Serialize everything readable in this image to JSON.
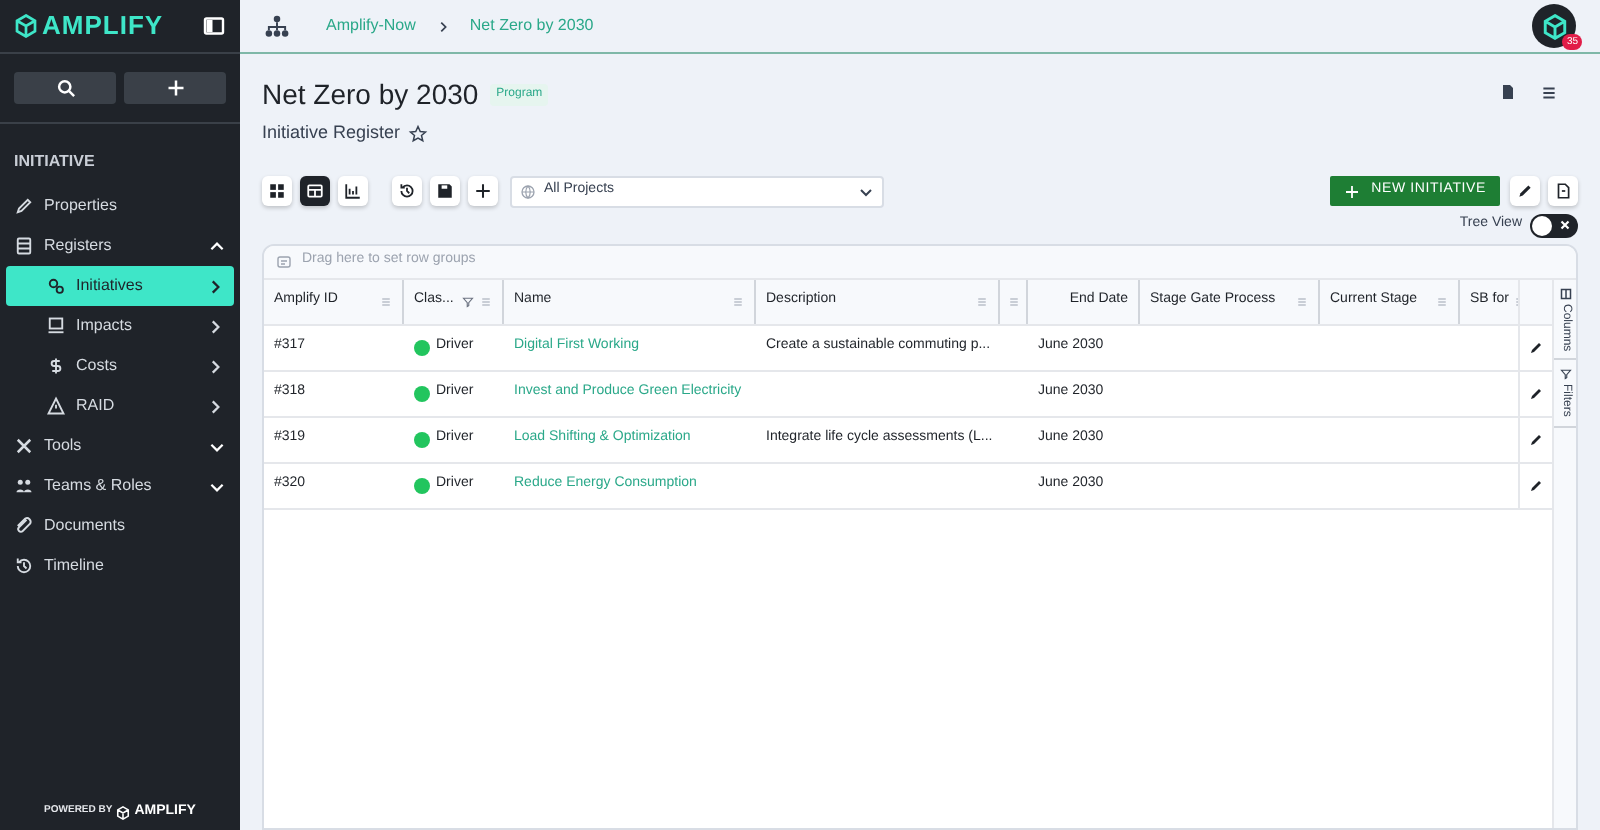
{
  "sidebar": {
    "logo": "AMPLIFY",
    "section": "INITIATIVE",
    "items": [
      {
        "label": "Properties",
        "kind": "link"
      },
      {
        "label": "Registers",
        "kind": "group",
        "expanded": true,
        "children": [
          {
            "label": "Initiatives",
            "selected": true
          },
          {
            "label": "Impacts",
            "selected": false
          },
          {
            "label": "Costs",
            "selected": false
          },
          {
            "label": "RAID",
            "selected": false
          }
        ]
      },
      {
        "label": "Tools",
        "kind": "group",
        "expanded": false
      },
      {
        "label": "Teams & Roles",
        "kind": "group",
        "expanded": false
      },
      {
        "label": "Documents",
        "kind": "link"
      },
      {
        "label": "Timeline",
        "kind": "link"
      }
    ],
    "footer_prefix": "POWERED BY",
    "footer_brand": "AMPLIFY"
  },
  "breadcrumb": [
    "Amplify-Now",
    "Net Zero by 2030"
  ],
  "avatar_badge": "35",
  "page": {
    "title": "Net Zero by 2030",
    "tag": "Program",
    "subtitle": "Initiative Register"
  },
  "toolbar": {
    "views": [
      {
        "kind": "tiles",
        "selected": false
      },
      {
        "kind": "table",
        "selected": true
      },
      {
        "kind": "chart",
        "selected": false
      }
    ],
    "project_select": "All Projects",
    "new_button": "NEW INITIATIVE",
    "tree_view": {
      "label": "Tree View",
      "on": false
    }
  },
  "grid": {
    "group_hint": "Drag here to set row groups",
    "columns": [
      {
        "label": "Amplify ID",
        "filtered": false
      },
      {
        "label": "Clas...",
        "filtered": true
      },
      {
        "label": "Name",
        "filtered": false
      },
      {
        "label": "Description",
        "filtered": false
      },
      {
        "label": "End Date",
        "filtered": false
      },
      {
        "label": "Stage Gate Process",
        "filtered": false
      },
      {
        "label": "Current Stage",
        "filtered": false
      },
      {
        "label": "SB for",
        "filtered": false
      }
    ],
    "rows": [
      {
        "id": "#317",
        "class": "Driver",
        "color": "#22c55e",
        "name": "Digital First Working",
        "description": "Create a sustainable commuting p...",
        "end_date": "June 2030"
      },
      {
        "id": "#318",
        "class": "Driver",
        "color": "#22c55e",
        "name": "Invest and Produce Green Electricity",
        "end_date": "June 2030"
      },
      {
        "id": "#319",
        "class": "Driver",
        "color": "#22c55e",
        "name": "Load Shifting & Optimization",
        "description": "Integrate life cycle assessments (L...",
        "end_date": "June 2030"
      },
      {
        "id": "#320",
        "class": "Driver",
        "color": "#22c55e",
        "name": "Reduce Energy Consumption",
        "end_date": "June 2030"
      }
    ],
    "side_tabs": [
      "Columns",
      "Filters"
    ]
  }
}
